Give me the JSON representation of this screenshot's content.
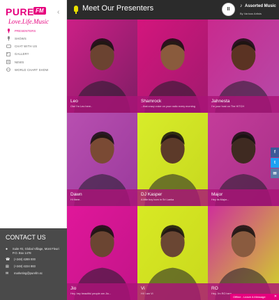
{
  "brand": {
    "logo_word": "PURE",
    "logo_fm": "FM",
    "tagline": "Love.Life.Music"
  },
  "sidebar": {
    "items": [
      {
        "label": "PRESENTERS",
        "icon": "mic-icon",
        "glyph": "🎤",
        "active": true
      },
      {
        "label": "SHOWS",
        "icon": "mic-icon",
        "glyph": "▮",
        "active": false
      },
      {
        "label": "CHAT WITH US",
        "icon": "chat-icon",
        "glyph": "▭",
        "active": false
      },
      {
        "label": "GALLERY",
        "icon": "gallery-icon",
        "glyph": "▣",
        "active": false
      },
      {
        "label": "NEWS",
        "icon": "news-icon",
        "glyph": "▤",
        "active": false
      },
      {
        "label": "WORLD CHART SHOW",
        "icon": "globe-icon",
        "glyph": "◍",
        "active": false
      }
    ]
  },
  "contact": {
    "title": "CONTACT US",
    "address": "Suite #2, Global Village, Mont Fleuri P.O. Box 1478",
    "phone1": "(+248) 4289 000",
    "phone2": "(+248) 4224 883",
    "email": "marketing@purefm.sc"
  },
  "header": {
    "title": "Meet Our Presenters"
  },
  "player": {
    "title": "Assorted Music",
    "artist": "By Various Artists",
    "play_glyph": "II"
  },
  "presenters": [
    {
      "name": "Leo",
      "line": "Ola! I'm Leo here..",
      "bg": "#cc1f86",
      "bg2": "#7f1d65",
      "skin": "#6b4331"
    },
    {
      "name": "Shamrock",
      "line": "...that crazy voice on your radio every morning",
      "bg": "#d4157d",
      "bg2": "#a01a6e",
      "skin": "#8a5b3d"
    },
    {
      "name": "Jahnesta",
      "line": "I'm your host on The HITCH",
      "bg": "#c92a8e",
      "bg2": "#b54aa8",
      "skin": "#5b3323"
    },
    {
      "name": "Dawn",
      "line": "Hi there..",
      "bg": "#b84fb0",
      "bg2": "#9a3a9c",
      "skin": "#7a4a34"
    },
    {
      "name": "DJ Kasper",
      "line": "A little boy born in Sri Lanka",
      "bg": "#d8ec2a",
      "bg2": "#c7d81e",
      "skin": "#5c3a29"
    },
    {
      "name": "Major",
      "line": "Hey its Major...",
      "bg": "#c43c9a",
      "bg2": "#a73088",
      "skin": "#3f2a21"
    },
    {
      "name": "Jio",
      "line": "Hey, hey beautiful people am Jio...",
      "bg": "#e0179a",
      "bg2": "#c21488",
      "skin": "#6b4532"
    },
    {
      "name": "Vi",
      "line": "Hi! I am Vi",
      "bg": "#d8e924",
      "bg2": "#c9d91d",
      "skin": "#6a4633"
    },
    {
      "name": "RO",
      "line": "Hey, I'm RO here...",
      "bg": "#cf2f9a",
      "bg2": "#d0d628",
      "skin": "#8a5b3f"
    }
  ],
  "social": {
    "fb": "f",
    "tw": "t",
    "em": "✉"
  },
  "offline": {
    "text": "Offline - Leave A Message",
    "close": "✕"
  },
  "colors": {
    "accent": "#e6007e",
    "header_bg": "#2b2b2b",
    "sidebar_contact_bg": "#4a4a4a"
  }
}
